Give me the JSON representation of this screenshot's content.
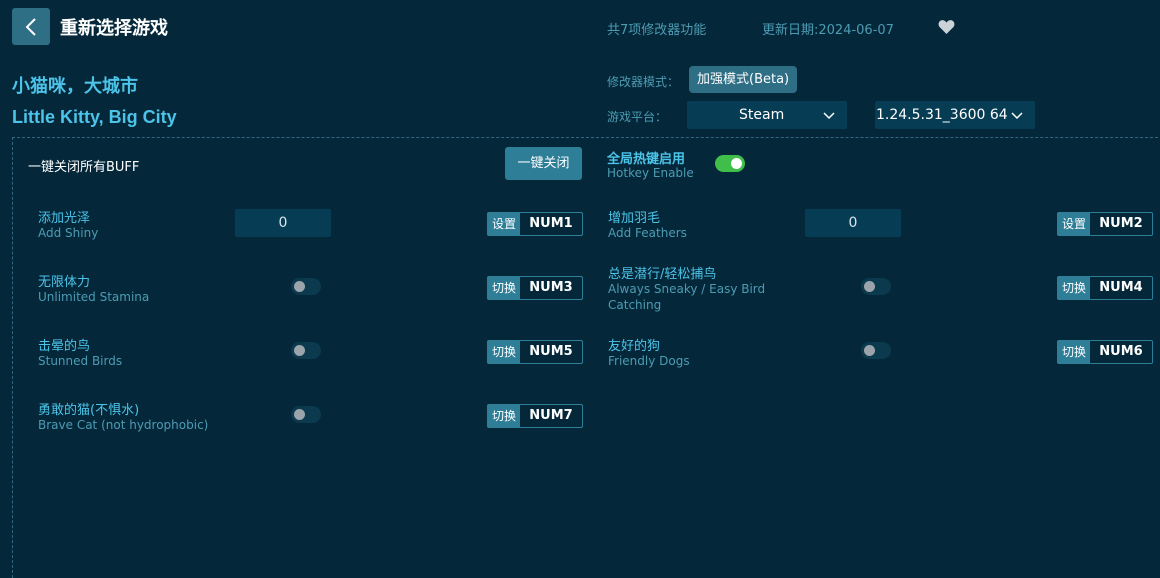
{
  "header": {
    "title": "重新选择游戏",
    "feature_count": "共7项修改器功能",
    "update_date": "更新日期:2024-06-07"
  },
  "game": {
    "name_cn": "小猫咪，大城市",
    "name_en": "Little Kitty, Big City"
  },
  "settings": {
    "mode_label": "修改器模式：",
    "mode_value": "加强模式(Beta)",
    "platform_label": "游戏平台：",
    "platform_value": "Steam",
    "version_value": "1.24.5.31_3600 64"
  },
  "controls": {
    "close_all_label": "一键关闭所有BUFF",
    "close_all_button": "一键关闭",
    "hotkey_cn": "全局热键启用",
    "hotkey_en": "Hotkey Enable",
    "hotkey_enabled": true
  },
  "options": [
    {
      "cn": "添加光泽",
      "en": "Add Shiny",
      "type": "input",
      "value": "0",
      "action": "设置",
      "key": "NUM1"
    },
    {
      "cn": "增加羽毛",
      "en": "Add Feathers",
      "type": "input",
      "value": "0",
      "action": "设置",
      "key": "NUM2"
    },
    {
      "cn": "无限体力",
      "en": "Unlimited Stamina",
      "type": "toggle",
      "on": false,
      "action": "切换",
      "key": "NUM3"
    },
    {
      "cn": "总是潜行/轻松捕鸟",
      "en": "Always Sneaky / Easy Bird Catching",
      "type": "toggle",
      "on": false,
      "action": "切换",
      "key": "NUM4"
    },
    {
      "cn": "击晕的鸟",
      "en": "Stunned Birds",
      "type": "toggle",
      "on": false,
      "action": "切换",
      "key": "NUM5"
    },
    {
      "cn": "友好的狗",
      "en": "Friendly Dogs",
      "type": "toggle",
      "on": false,
      "action": "切换",
      "key": "NUM6"
    },
    {
      "cn": "勇敢的猫(不惧水)",
      "en": "Brave Cat (not hydrophobic)",
      "type": "toggle",
      "on": false,
      "action": "切换",
      "key": "NUM7"
    }
  ],
  "icons": {
    "back": "chevron-left-icon",
    "favorite": "heart-icon",
    "dropdown": "chevron-down-icon"
  },
  "colors": {
    "background": "#04283a",
    "accent": "#2e7e98",
    "title_text": "#4cc3e8",
    "toggle_on": "#3fbe4a"
  }
}
